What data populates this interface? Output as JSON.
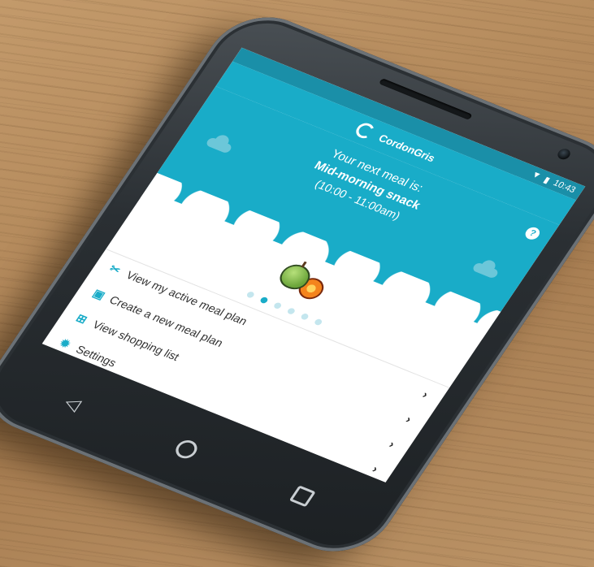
{
  "status_bar": {
    "time": "10:43"
  },
  "app": {
    "name": "CordonGris"
  },
  "hero": {
    "intro": "Your next meal is:",
    "meal_name": "Mid-morning snack",
    "time_range": "(10:00 - 11:00am)",
    "help_label": "?"
  },
  "carousel": {
    "dot_count": 6,
    "active_index": 1
  },
  "menu": {
    "items": [
      {
        "label": "View my active meal plan",
        "icon": "utensils-icon"
      },
      {
        "label": "Create a new meal plan",
        "icon": "calendar-icon"
      },
      {
        "label": "View shopping list",
        "icon": "cart-icon"
      },
      {
        "label": "Settings",
        "icon": "gear-icon"
      }
    ]
  },
  "colors": {
    "accent": "#19acc8",
    "status": "#1a8fa8"
  }
}
